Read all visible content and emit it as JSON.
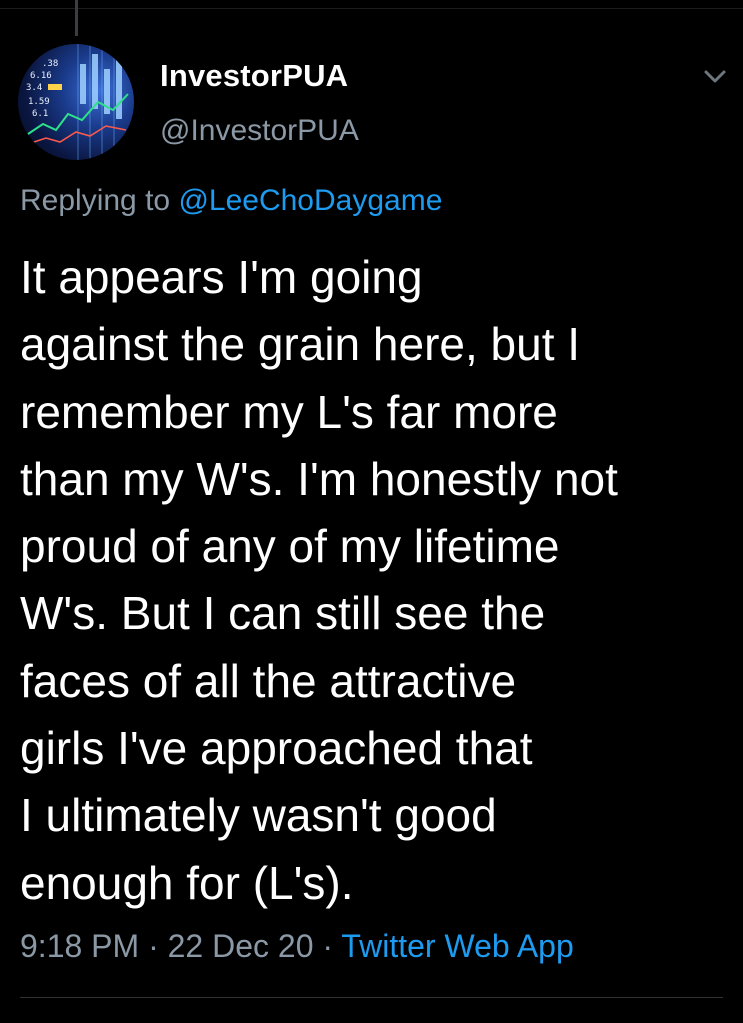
{
  "tweet": {
    "author": {
      "display_name": "InvestorPUA",
      "handle": "@InvestorPUA",
      "avatar_icon": "stock-ticker-avatar"
    },
    "reply_prefix": "Replying to ",
    "reply_to": "@LeeChoDaygame",
    "body_lines": [
      "It appears I'm going",
      "against the grain here, but I",
      "remember my L's far more",
      "than my W's. I'm honestly not",
      "proud of any of my lifetime",
      "W's. But I can still see the",
      "faces of all the attractive",
      "girls I've approached that",
      "I ultimately wasn't good",
      "enough for (L's)."
    ],
    "time": "9:18 PM",
    "separator": " · ",
    "date": "22 Dec 20",
    "source": "Twitter Web App"
  },
  "colors": {
    "background": "#000000",
    "text": "#ffffff",
    "muted": "#8b98a5",
    "link": "#1d9bf0"
  }
}
